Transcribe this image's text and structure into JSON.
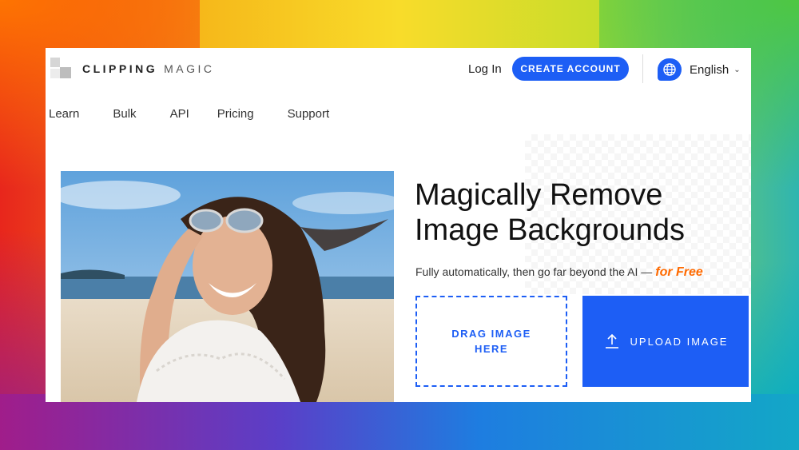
{
  "brand": {
    "name_bold": "CLIPPING",
    "name_light": "MAGIC"
  },
  "header": {
    "login_label": "Log In",
    "create_account_label": "CREATE ACCOUNT",
    "language_label": "English"
  },
  "nav": {
    "items": [
      "Learn",
      "Bulk",
      "API",
      "Pricing",
      "Support"
    ]
  },
  "hero": {
    "headline_line1": "Magically Remove",
    "headline_line2": "Image Backgrounds",
    "subtitle": "Fully automatically, then go far beyond the AI —",
    "subtitle_accent": "for Free",
    "drag_label": "DRAG IMAGE HERE",
    "upload_label": "UPLOAD IMAGE"
  },
  "colors": {
    "accent": "#1d5ef5",
    "accent_orange": "#ff6a00"
  },
  "icons": {
    "globe": "globe-icon",
    "chevron": "chevron-down-icon",
    "upload": "upload-icon"
  }
}
